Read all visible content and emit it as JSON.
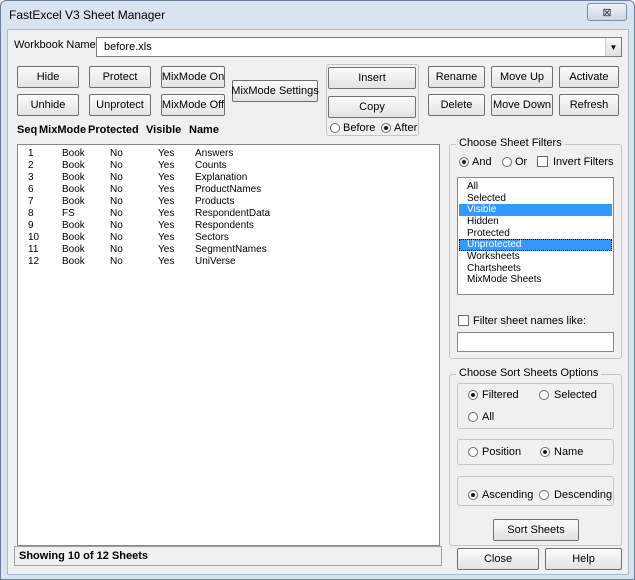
{
  "window": {
    "title": "FastExcel V3 Sheet Manager",
    "close_glyph": "⊠"
  },
  "workbook": {
    "label": "Workbook Name",
    "value": "before.xls",
    "arrow": "▼"
  },
  "buttons": {
    "hide": "Hide",
    "unhide": "Unhide",
    "protect": "Protect",
    "unprotect": "Unprotect",
    "mixmode_on": "MixMode On",
    "mixmode_off": "MixMode Off",
    "mixmode_settings": "MixMode Settings",
    "insert": "Insert",
    "copy": "Copy",
    "rename": "Rename",
    "delete": "Delete",
    "move_up": "Move Up",
    "move_down": "Move Down",
    "activate": "Activate",
    "refresh": "Refresh"
  },
  "position_options": {
    "before": "Before",
    "after": "After",
    "selected": "after"
  },
  "list_headers": {
    "seq": "Seq",
    "mixmode": "MixMode",
    "protected": "Protected",
    "visible": "Visible",
    "name": "Name"
  },
  "sheets": [
    {
      "seq": "1",
      "mixmode": "Book",
      "protected": "No",
      "visible": "Yes",
      "name": "Answers"
    },
    {
      "seq": "2",
      "mixmode": "Book",
      "protected": "No",
      "visible": "Yes",
      "name": "Counts"
    },
    {
      "seq": "3",
      "mixmode": "Book",
      "protected": "No",
      "visible": "Yes",
      "name": "Explanation"
    },
    {
      "seq": "6",
      "mixmode": "Book",
      "protected": "No",
      "visible": "Yes",
      "name": "ProductNames"
    },
    {
      "seq": "7",
      "mixmode": "Book",
      "protected": "No",
      "visible": "Yes",
      "name": "Products"
    },
    {
      "seq": "8",
      "mixmode": "FS",
      "protected": "No",
      "visible": "Yes",
      "name": "RespondentData"
    },
    {
      "seq": "9",
      "mixmode": "Book",
      "protected": "No",
      "visible": "Yes",
      "name": "Respondents"
    },
    {
      "seq": "10",
      "mixmode": "Book",
      "protected": "No",
      "visible": "Yes",
      "name": "Sectors"
    },
    {
      "seq": "11",
      "mixmode": "Book",
      "protected": "No",
      "visible": "Yes",
      "name": "SegmentNames"
    },
    {
      "seq": "12",
      "mixmode": "Book",
      "protected": "No",
      "visible": "Yes",
      "name": "UniVerse"
    }
  ],
  "filters": {
    "title": "Choose Sheet Filters",
    "and_label": "And",
    "or_label": "Or",
    "invert_label": "Invert Filters",
    "logic_selected": "and",
    "invert_checked": false,
    "items": [
      "All",
      "Selected",
      "Visible",
      "Hidden",
      "Protected",
      "Unprotected",
      "Worksheets",
      "Chartsheets",
      "MixMode Sheets"
    ],
    "selected_items": [
      "Visible",
      "Unprotected"
    ],
    "name_filter_label": "Filter sheet names like:",
    "name_filter_checked": false,
    "name_filter_value": ""
  },
  "sort": {
    "title": "Choose Sort Sheets Options",
    "filtered": "Filtered",
    "selected": "Selected",
    "all": "All",
    "scope_selected": "filtered",
    "position": "Position",
    "name": "Name",
    "key_selected": "name",
    "ascending": "Ascending",
    "descending": "Descending",
    "order_selected": "ascending",
    "button": "Sort Sheets"
  },
  "status": {
    "text": "Showing 10 of 12 Sheets"
  },
  "footer": {
    "close": "Close",
    "help": "Help"
  }
}
